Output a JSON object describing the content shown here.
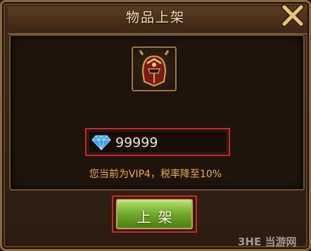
{
  "dialog": {
    "title": "物品上架",
    "price_value": "99999",
    "vip_notice": "您当前为VIP4，税率降至10%",
    "confirm_label": "上架"
  },
  "icons": {
    "close": "close-x-icon",
    "item": "helmet-icon",
    "currency": "diamond-icon"
  },
  "watermark": "3HE 当游网",
  "colors": {
    "title_text": "#f3e2b6",
    "notice_text": "#e8b23a",
    "button_green": "#6fa82a",
    "highlight_red": "#d4232a",
    "gem_blue": "#3aa0ff"
  }
}
